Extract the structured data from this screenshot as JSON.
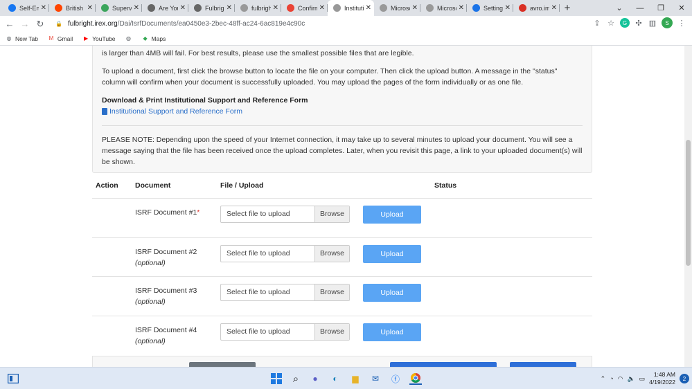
{
  "tabs": [
    {
      "title": "Self-Em",
      "icon": "facebook-icon",
      "color": "#1877f2"
    },
    {
      "title": "British",
      "icon": "reddit-icon",
      "color": "#ff4500"
    },
    {
      "title": "Superv",
      "icon": "checkbox-app-icon",
      "color": "#3ba55c"
    },
    {
      "title": "Are You",
      "icon": "globe-icon",
      "color": "#666666"
    },
    {
      "title": "Fulbrigh",
      "icon": "globe-icon",
      "color": "#666666"
    },
    {
      "title": "fulbrigh",
      "icon": "document-icon",
      "color": "#999999"
    },
    {
      "title": "Confirm",
      "icon": "gmail-icon",
      "color": "#ea4335"
    },
    {
      "title": "Institutio",
      "icon": "document-icon",
      "color": "#999999",
      "active": true
    },
    {
      "title": "Microsc",
      "icon": "document-icon",
      "color": "#999999"
    },
    {
      "title": "Microsc",
      "icon": "document-icon",
      "color": "#999999"
    },
    {
      "title": "Setting",
      "icon": "gear-icon",
      "color": "#1a73e8"
    },
    {
      "title": "avro.im",
      "icon": "avro-icon",
      "color": "#d93025"
    }
  ],
  "url": {
    "domain": "fulbright.irex.org",
    "path": "/Dai/IsrfDocuments/ea0450e3-2bec-48ff-ac24-6ac819e4c90c"
  },
  "bookmarks": [
    {
      "label": "New Tab",
      "icon": "globe-icon"
    },
    {
      "label": "Gmail",
      "icon": "gmail-icon"
    },
    {
      "label": "YouTube",
      "icon": "youtube-icon"
    },
    {
      "label": "",
      "icon": "globe-icon"
    },
    {
      "label": "Maps",
      "icon": "maps-icon"
    }
  ],
  "profile_initial": "S",
  "info": {
    "line1": "is larger than 4MB will fail. For best results, please use the smallest possible files that are legible.",
    "para2": "To upload a document, first click the browse button to locate the file on your computer. Then click the upload button. A message in the \"status\" column will confirm when your document is successfully uploaded. You may upload the pages of the form individually or as one file.",
    "download_heading": "Download & Print Institutional Support and Reference Form",
    "download_link": "Institutional Support and Reference Form",
    "note": "PLEASE NOTE: Depending upon the speed of your Internet connection, it may take up to several minutes to upload your document. You will see a message saying that the file has been received once the upload completes. Later, when you revisit this page, a link to your uploaded document(s) will be shown."
  },
  "table": {
    "headers": {
      "action": "Action",
      "document": "Document",
      "file": "File / Upload",
      "status": "Status"
    },
    "rows": [
      {
        "doc": "ISRF Document #1",
        "required": "*",
        "optional": "",
        "placeholder": "Select file to upload",
        "browse": "Browse",
        "upload": "Upload"
      },
      {
        "doc": "ISRF Document #2",
        "required": "",
        "optional": "(optional)",
        "placeholder": "Select file to upload",
        "browse": "Browse",
        "upload": "Upload"
      },
      {
        "doc": "ISRF Document #3",
        "required": "",
        "optional": "(optional)",
        "placeholder": "Select file to upload",
        "browse": "Browse",
        "upload": "Upload"
      },
      {
        "doc": "ISRF Document #4",
        "required": "",
        "optional": "(optional)",
        "placeholder": "Select file to upload",
        "browse": "Browse",
        "upload": "Upload"
      }
    ]
  },
  "taskbar": {
    "time": "1:48 AM",
    "date": "4/19/2022",
    "notifications": "2"
  }
}
